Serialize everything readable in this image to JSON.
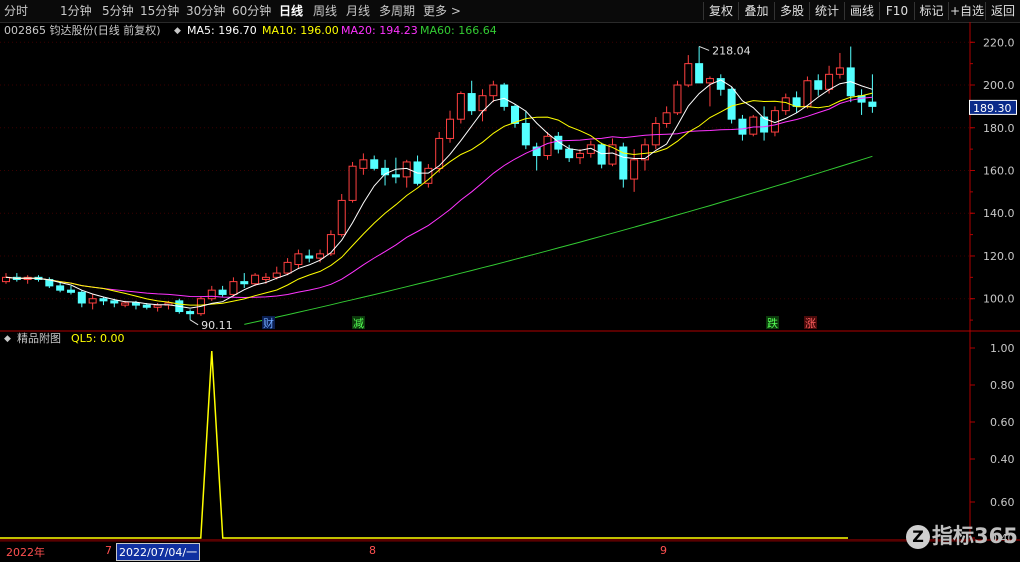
{
  "toolbar": {
    "periods": [
      {
        "label": "分时",
        "active": false
      },
      {
        "label": "1分钟",
        "active": false
      },
      {
        "label": "5分钟",
        "active": false
      },
      {
        "label": "15分钟",
        "active": false
      },
      {
        "label": "30分钟",
        "active": false
      },
      {
        "label": "60分钟",
        "active": false
      },
      {
        "label": "日线",
        "active": true
      },
      {
        "label": "周线",
        "active": false
      },
      {
        "label": "月线",
        "active": false
      },
      {
        "label": "多周期",
        "active": false
      },
      {
        "label": "更多",
        "active": false
      }
    ],
    "more_arrow": ">",
    "right_buttons": [
      "复权",
      "叠加",
      "多股",
      "统计",
      "画线",
      "F10",
      "标记",
      "+自选",
      "返回"
    ]
  },
  "main_chart": {
    "title": "002865 钧达股份(日线 前复权)",
    "ma5": {
      "label": "MA5: 196.70",
      "color": "#ffffff"
    },
    "ma10": {
      "label": "MA10: 196.00",
      "color": "#ffff00"
    },
    "ma20": {
      "label": "MA20: 194.23",
      "color": "#ff33ff"
    },
    "ma60": {
      "label": "MA60: 166.64",
      "color": "#33cc33"
    },
    "high_marker": "218.04",
    "low_marker": "90.11",
    "current_price": "189.30",
    "up_color": "#ff4040",
    "down_color": "#54ffff",
    "event_tags": [
      {
        "text": "财",
        "color": "#6fa8ff",
        "bg": "#0a1e50"
      },
      {
        "text": "减",
        "color": "#55ff55",
        "bg": "#0c3a0c"
      },
      {
        "text": "跌",
        "color": "#55ff55",
        "bg": "#0c3a0c"
      },
      {
        "text": "涨",
        "color": "#ff6060",
        "bg": "#4a0a0a"
      }
    ]
  },
  "sub_chart": {
    "title": "精品附图",
    "ql5": {
      "label": "QL5: 0.00",
      "color": "#ffff00"
    }
  },
  "chart_data": [
    {
      "type": "candlestick",
      "title": "002865 钧达股份(日线 前复权)",
      "ylim": [
        87,
        228
      ],
      "y_ticks": [
        "220.0",
        "200.0",
        "180.0",
        "160.0",
        "140.0",
        "120.0",
        "100.0"
      ],
      "candles": [
        [
          108,
          112,
          107,
          110
        ],
        [
          110,
          112,
          108,
          109
        ],
        [
          109,
          111,
          107,
          110
        ],
        [
          110,
          111,
          108,
          109
        ],
        [
          109,
          110,
          105,
          106
        ],
        [
          106,
          108,
          103,
          104
        ],
        [
          104,
          106,
          102,
          103
        ],
        [
          103,
          104,
          96,
          98
        ],
        [
          98,
          102,
          95,
          100
        ],
        [
          100,
          101,
          97,
          99
        ],
        [
          99,
          100,
          96,
          98
        ],
        [
          97,
          99,
          96,
          98
        ],
        [
          98,
          99,
          95,
          97
        ],
        [
          97,
          98,
          95,
          96
        ],
        [
          96,
          98,
          94,
          97
        ],
        [
          97,
          99,
          95,
          98
        ],
        [
          99,
          100,
          93,
          94
        ],
        [
          94,
          95,
          90.11,
          93
        ],
        [
          93,
          101,
          92,
          100
        ],
        [
          100,
          106,
          99,
          104
        ],
        [
          104,
          106,
          101,
          102
        ],
        [
          102,
          110,
          101,
          108
        ],
        [
          108,
          112,
          105,
          107
        ],
        [
          107,
          112,
          106,
          111
        ],
        [
          109,
          112,
          107,
          110
        ],
        [
          110,
          115,
          109,
          112
        ],
        [
          112,
          119,
          111,
          117
        ],
        [
          116,
          123,
          114,
          121
        ],
        [
          120,
          123,
          117,
          119
        ],
        [
          119,
          123,
          117,
          121
        ],
        [
          121,
          132,
          120,
          130
        ],
        [
          130,
          149,
          129,
          146
        ],
        [
          146,
          164,
          145,
          162
        ],
        [
          161,
          168,
          158,
          165
        ],
        [
          165,
          167,
          160,
          161
        ],
        [
          161,
          165,
          153,
          158
        ],
        [
          158,
          166,
          154,
          157
        ],
        [
          157,
          165,
          152,
          164
        ],
        [
          164,
          167,
          153,
          154
        ],
        [
          154,
          163,
          152,
          161
        ],
        [
          161,
          178,
          159,
          175
        ],
        [
          175,
          188,
          173,
          184
        ],
        [
          184,
          197,
          182,
          196
        ],
        [
          196,
          202,
          186,
          188
        ],
        [
          188,
          198,
          183,
          195
        ],
        [
          195,
          202,
          192,
          200
        ],
        [
          200,
          201,
          188,
          190
        ],
        [
          190,
          191,
          180,
          182
        ],
        [
          182,
          188,
          170,
          172
        ],
        [
          171,
          173,
          160,
          167
        ],
        [
          167,
          178,
          165,
          176
        ],
        [
          176,
          178,
          168,
          170
        ],
        [
          170,
          172,
          164,
          166
        ],
        [
          166,
          170,
          163,
          168
        ],
        [
          168,
          174,
          166,
          172
        ],
        [
          172,
          173,
          161,
          163
        ],
        [
          163,
          175,
          162,
          172
        ],
        [
          171,
          173,
          152,
          156
        ],
        [
          156,
          170,
          150,
          165
        ],
        [
          165,
          175,
          160,
          172
        ],
        [
          172,
          185,
          170,
          182
        ],
        [
          182,
          190,
          180,
          187
        ],
        [
          187,
          202,
          186,
          200
        ],
        [
          200,
          214,
          199,
          210
        ],
        [
          210,
          218.04,
          206,
          201
        ],
        [
          201,
          204,
          190,
          203
        ],
        [
          203,
          205,
          195,
          198
        ],
        [
          198,
          199,
          182,
          184
        ],
        [
          184,
          186,
          174,
          177
        ],
        [
          177,
          186,
          176,
          185
        ],
        [
          185,
          190,
          174,
          178
        ],
        [
          178,
          190,
          176,
          188
        ],
        [
          188,
          196,
          186,
          194
        ],
        [
          194,
          197,
          187,
          190
        ],
        [
          190,
          204,
          189,
          202
        ],
        [
          202,
          205,
          195,
          198
        ],
        [
          198,
          209,
          196,
          205
        ],
        [
          205,
          215,
          203,
          208
        ],
        [
          208,
          218,
          192,
          195
        ],
        [
          195,
          198,
          186,
          192
        ],
        [
          192,
          205,
          187,
          190
        ]
      ],
      "ma5": {
        "name": "MA5",
        "color": "#ffffff",
        "last": 196.7
      },
      "ma10": {
        "name": "MA10",
        "color": "#ffff00",
        "last": 196.0
      },
      "ma20": {
        "name": "MA20",
        "color": "#ff33ff",
        "last": 194.23
      },
      "ma60": {
        "name": "MA60",
        "color": "#33cc33",
        "last": 166.64
      },
      "annotations": [
        {
          "label": "218.04",
          "candle_index": 64,
          "kind": "high"
        },
        {
          "label": "90.11",
          "candle_index": 17,
          "kind": "low"
        }
      ],
      "current_price": 189.3
    },
    {
      "type": "line",
      "title": "精品附图",
      "ylim": [
        0.6,
        1.0
      ],
      "y_ticks": [
        "1.00",
        "0.80",
        "0.60",
        "0.40",
        "0.60",
        "0.40"
      ],
      "series": [
        {
          "name": "QL5",
          "color": "#ffff00",
          "spike_at_index": 19,
          "spike_value": 1.0,
          "base_value": 0.0
        }
      ]
    }
  ],
  "time_axis": {
    "labels": [
      {
        "text": "2022年",
        "boxed": false
      },
      {
        "text": "7",
        "boxed": false
      },
      {
        "text": "2022/07/04/一",
        "boxed": true
      },
      {
        "text": "8",
        "boxed": false
      },
      {
        "text": "9",
        "boxed": false
      }
    ]
  },
  "watermark": {
    "mark": "Z",
    "text": "指标365"
  }
}
